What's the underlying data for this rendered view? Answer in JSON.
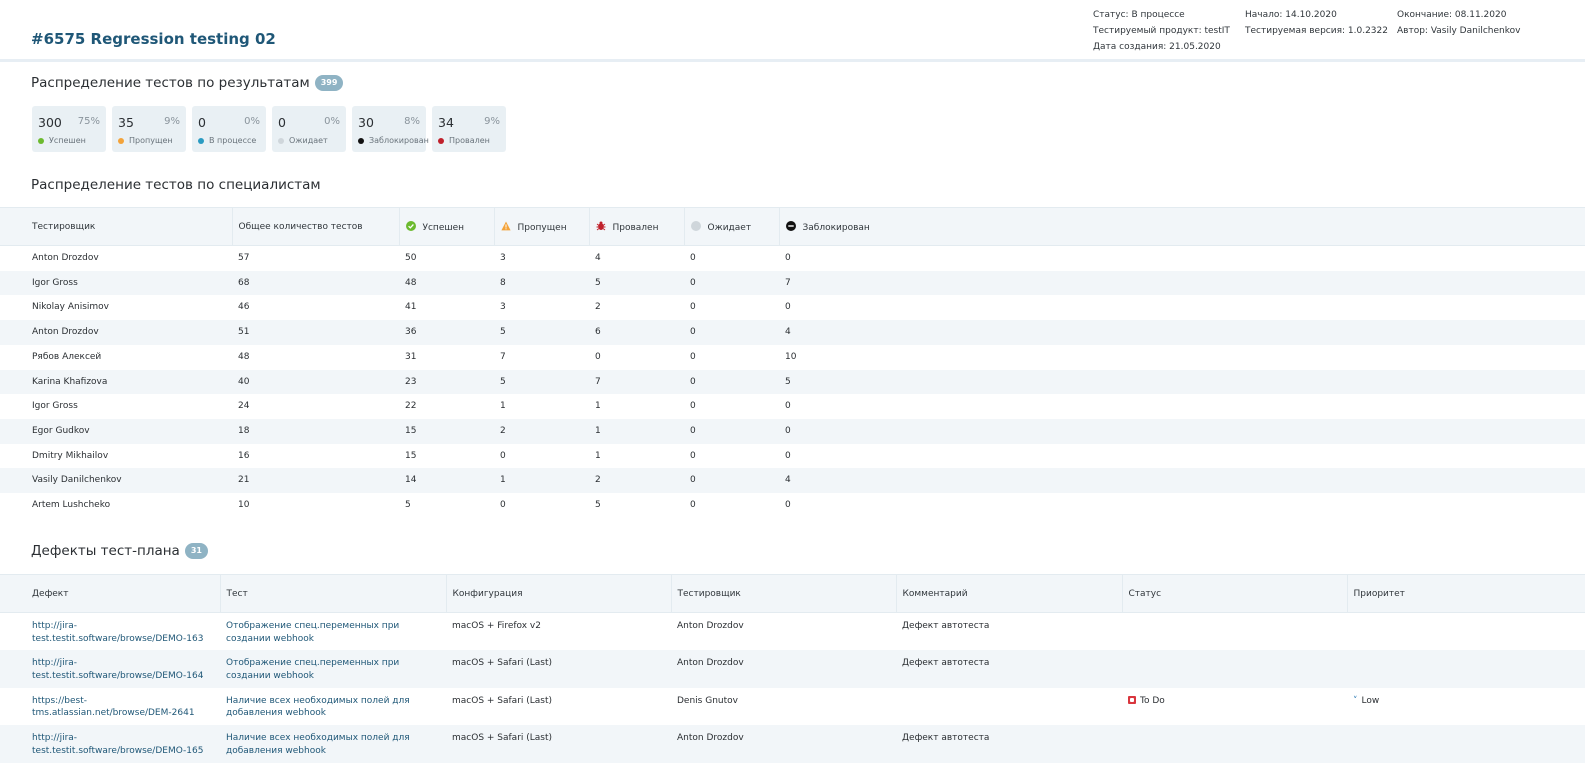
{
  "header": {
    "title": "#6575 Regression testing 02",
    "status": "Статус: В процессе",
    "product": "Тестируемый продукт: testIT",
    "created": "Дата создания: 21.05.2020",
    "start": "Начало: 14.10.2020",
    "version": "Тестируемая версия: 1.0.2322",
    "end": "Окончание: 08.11.2020",
    "author": "Автор: Vasily Danilchenkov"
  },
  "results": {
    "title": "Распределение тестов по результатам",
    "total": "399",
    "cards": [
      {
        "count": "300",
        "pct": "75%",
        "label": "Успешен",
        "color": "#6cba2f"
      },
      {
        "count": "35",
        "pct": "9%",
        "label": "Пропущен",
        "color": "#f3a33a"
      },
      {
        "count": "0",
        "pct": "0%",
        "label": "В процессе",
        "color": "#2a9bc2"
      },
      {
        "count": "0",
        "pct": "0%",
        "label": "Ожидает",
        "color": "#cfd6db"
      },
      {
        "count": "30",
        "pct": "8%",
        "label": "Заблокирован",
        "color": "#111111"
      },
      {
        "count": "34",
        "pct": "9%",
        "label": "Провален",
        "color": "#c0202b"
      }
    ]
  },
  "specialists": {
    "title": "Распределение тестов по специалистам",
    "headers": [
      "Тестировщик",
      "Общее количество тестов",
      "Успешен",
      "Пропущен",
      "Провален",
      "Ожидает",
      "Заблокирован"
    ],
    "header_icons": [
      "",
      "",
      "check-circle-icon",
      "warning-triangle-icon",
      "bug-icon",
      "gray-circle-icon",
      "minus-circle-icon"
    ],
    "rows": [
      [
        "Anton Drozdov",
        "57",
        "50",
        "3",
        "4",
        "0",
        "0"
      ],
      [
        "Igor Gross",
        "68",
        "48",
        "8",
        "5",
        "0",
        "7"
      ],
      [
        "Nikolay Anisimov",
        "46",
        "41",
        "3",
        "2",
        "0",
        "0"
      ],
      [
        "Anton Drozdov",
        "51",
        "36",
        "5",
        "6",
        "0",
        "4"
      ],
      [
        "Рябов Алексей",
        "48",
        "31",
        "7",
        "0",
        "0",
        "10"
      ],
      [
        "Karina Khafizova",
        "40",
        "23",
        "5",
        "7",
        "0",
        "5"
      ],
      [
        "Igor Gross",
        "24",
        "22",
        "1",
        "1",
        "0",
        "0"
      ],
      [
        "Egor Gudkov",
        "18",
        "15",
        "2",
        "1",
        "0",
        "0"
      ],
      [
        "Dmitry Mikhailov",
        "16",
        "15",
        "0",
        "1",
        "0",
        "0"
      ],
      [
        "Vasily Danilchenkov",
        "21",
        "14",
        "1",
        "2",
        "0",
        "4"
      ],
      [
        "Artem Lushcheko",
        "10",
        "5",
        "0",
        "5",
        "0",
        "0"
      ]
    ]
  },
  "defects": {
    "title": "Дефекты тест-плана",
    "total": "31",
    "headers": [
      "Дефект",
      "Тест",
      "Конфигурация",
      "Тестировщик",
      "Комментарий",
      "Статус",
      "Приоритет"
    ],
    "rows": [
      {
        "defect": [
          "http://jira-",
          "test.testit.software/browse/DEMO-163"
        ],
        "test": [
          "Отображение спец.переменных при",
          "создании webhook"
        ],
        "config": "macOS + Firefox v2",
        "tester": "Anton Drozdov",
        "comment": "Дефект автотеста",
        "status": "",
        "priority": ""
      },
      {
        "defect": [
          "http://jira-",
          "test.testit.software/browse/DEMO-164"
        ],
        "test": [
          "Отображение спец.переменных при",
          "создании webhook"
        ],
        "config": "macOS + Safari (Last)",
        "tester": "Anton Drozdov",
        "comment": "Дефект автотеста",
        "status": "",
        "priority": ""
      },
      {
        "defect": [
          "https://best-",
          "tms.atlassian.net/browse/DEM-2641"
        ],
        "test": [
          "Наличие всех необходимых полей для",
          "добавления webhook"
        ],
        "config": "macOS + Safari (Last)",
        "tester": "Denis Gnutov",
        "comment": "",
        "status": "To Do",
        "priority": "Low"
      },
      {
        "defect": [
          "http://jira-",
          "test.testit.software/browse/DEMO-165"
        ],
        "test": [
          "Наличие всех необходимых полей для",
          "добавления webhook"
        ],
        "config": "macOS + Safari (Last)",
        "tester": "Anton Drozdov",
        "comment": "Дефект автотеста",
        "status": "",
        "priority": ""
      }
    ]
  }
}
